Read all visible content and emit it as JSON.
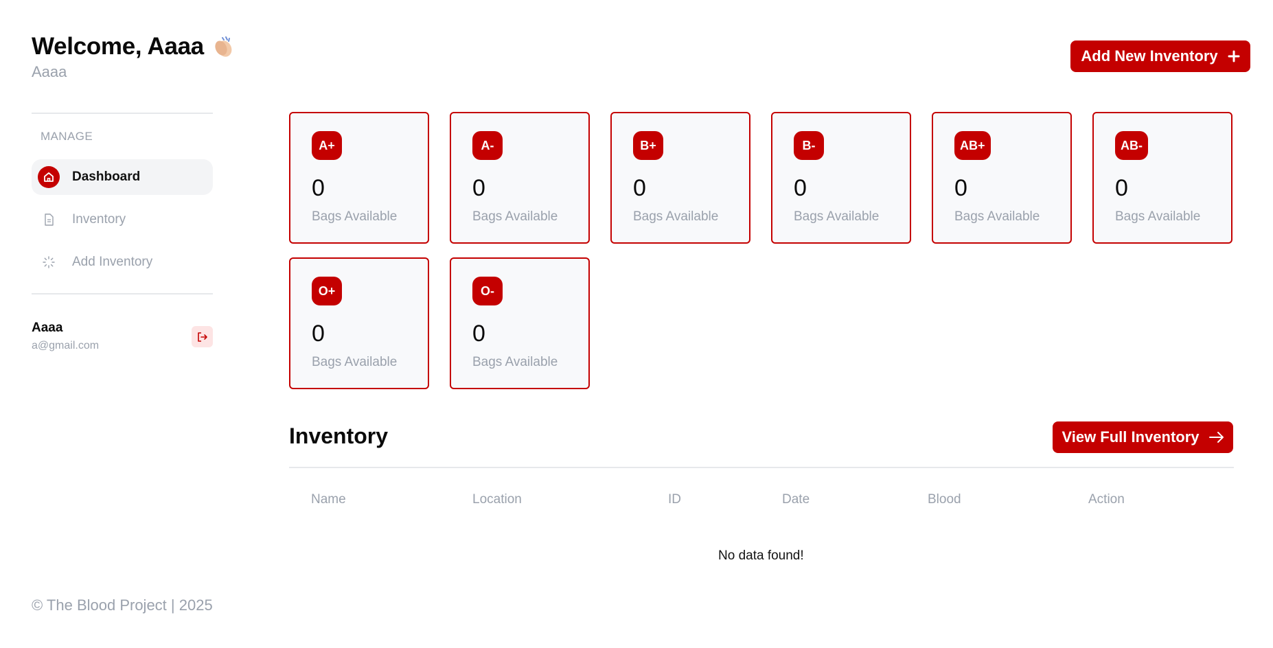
{
  "header": {
    "welcome": "Welcome, Aaaa",
    "subtitle": "Aaaa",
    "add_button": "Add New Inventory"
  },
  "sidebar": {
    "section_label": "MANAGE",
    "items": [
      {
        "label": "Dashboard",
        "icon": "home-icon",
        "active": true
      },
      {
        "label": "Inventory",
        "icon": "document-icon",
        "active": false
      },
      {
        "label": "Add Inventory",
        "icon": "loader-icon",
        "active": false
      }
    ],
    "user": {
      "name": "Aaaa",
      "email": "a@gmail.com"
    },
    "logout_icon": "logout-icon"
  },
  "blood_cards": [
    {
      "type": "A+",
      "count": "0",
      "label": "Bags Available"
    },
    {
      "type": "A-",
      "count": "0",
      "label": "Bags Available"
    },
    {
      "type": "B+",
      "count": "0",
      "label": "Bags Available"
    },
    {
      "type": "B-",
      "count": "0",
      "label": "Bags Available"
    },
    {
      "type": "AB+",
      "count": "0",
      "label": "Bags Available"
    },
    {
      "type": "AB-",
      "count": "0",
      "label": "Bags Available"
    },
    {
      "type": "O+",
      "count": "0",
      "label": "Bags Available"
    },
    {
      "type": "O-",
      "count": "0",
      "label": "Bags Available"
    }
  ],
  "inventory": {
    "title": "Inventory",
    "view_button": "View Full Inventory",
    "columns": [
      "Name",
      "Location",
      "ID",
      "Date",
      "Blood",
      "Action"
    ],
    "empty_message": "No data found!"
  },
  "footer": {
    "text": "© The Blood Project | 2025"
  },
  "colors": {
    "accent": "#c40000",
    "muted": "#9aa1ac",
    "card_bg": "#f8f9fb"
  }
}
